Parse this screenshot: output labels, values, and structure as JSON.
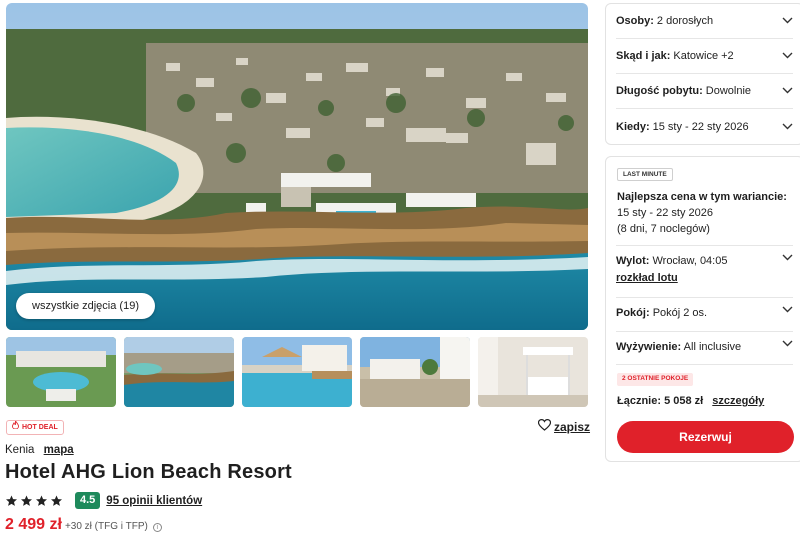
{
  "gallery": {
    "all_photos_label": "wszystkie zdjęcia (19)",
    "thumbnails": [
      "pool-area",
      "coastline",
      "pool-loungers",
      "resort-building",
      "bedroom"
    ]
  },
  "badges": {
    "hot_deal": "HOT DEAL"
  },
  "actions": {
    "save_label": "zapisz"
  },
  "location": {
    "country": "Kenia",
    "map_link": "mapa"
  },
  "hotel": {
    "name": "Hotel AHG Lion Beach Resort",
    "stars": 4,
    "score": "4.5",
    "reviews_label": "95 opinii klientów"
  },
  "price": {
    "main": "2 499 zł",
    "extra": "+30 zł (TFG i TFP)"
  },
  "options": [
    {
      "key": "Osoby:",
      "value": "2 dorosłych"
    },
    {
      "key": "Skąd i jak:",
      "value": "Katowice +2"
    },
    {
      "key": "Długość pobytu:",
      "value": "Dowolnie"
    },
    {
      "key": "Kiedy:",
      "value": "15 sty - 22 sty 2026"
    }
  ],
  "offer": {
    "tag": "LAST MINUTE",
    "best_title": "Najlepsza cena w tym wariancie:",
    "best_dates": "15 sty - 22 sty 2026",
    "best_nights": "(8 dni, 7 noclegów)",
    "flight_key": "Wylot:",
    "flight_value": "Wrocław, 04:05",
    "flight_link": "rozkład lotu",
    "room_key": "Pokój:",
    "room_value": "Pokój 2 os.",
    "board_key": "Wyżywienie:",
    "board_value": "All inclusive",
    "rooms_left": "2 OSTATNIE POKOJE",
    "total_label": "Łącznie: 5 058 zł",
    "details_link": "szczegóły",
    "book_label": "Rezerwuj"
  },
  "colors": {
    "accent": "#e0212a",
    "score_bg": "#1e8a5c"
  }
}
